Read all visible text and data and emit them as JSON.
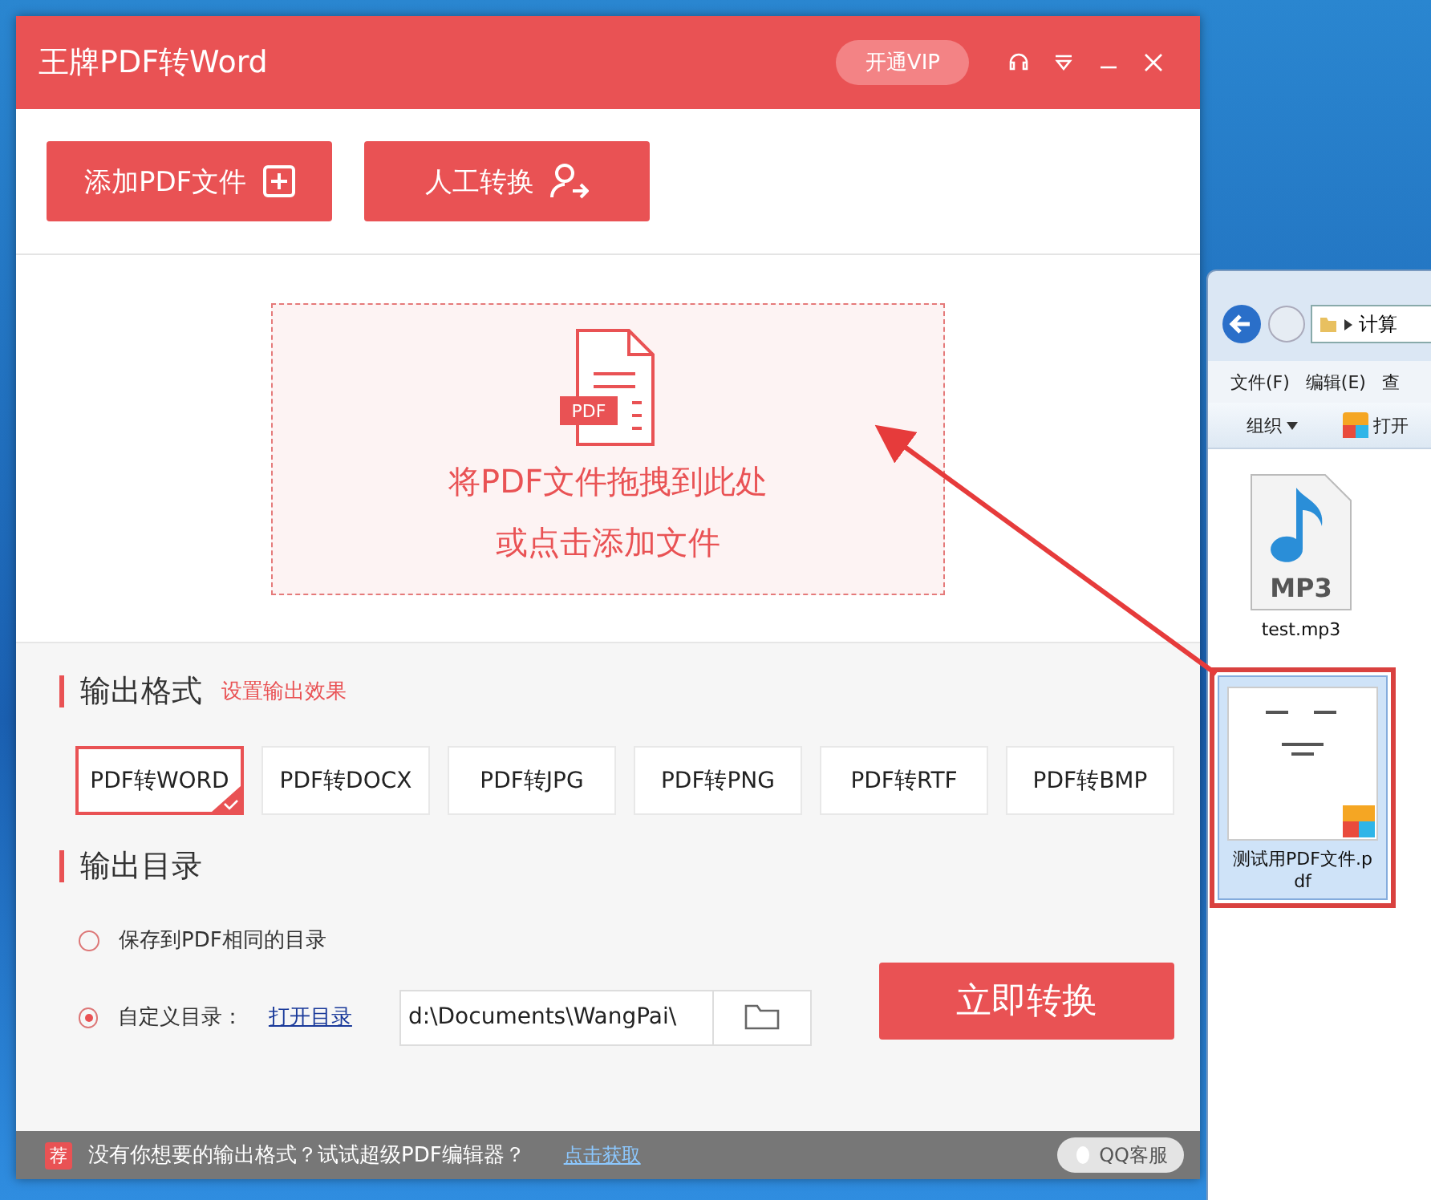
{
  "app": {
    "title": "王牌PDF转Word",
    "vip_button": "开通VIP",
    "toolbar": [
      {
        "label": "添加PDF文件",
        "kind": "add"
      },
      {
        "label": "人工转换",
        "kind": "person"
      }
    ],
    "drop_zone": {
      "badge": "PDF",
      "lines": [
        "将PDF文件拖拽到此处",
        "或点击添加文件"
      ]
    },
    "output_format": {
      "heading": "输出格式",
      "link": "设置输出效果",
      "options": [
        {
          "label": "PDF转WORD",
          "selected": true
        },
        {
          "label": "PDF转DOCX",
          "selected": false
        },
        {
          "label": "PDF转JPG",
          "selected": false
        },
        {
          "label": "PDF转PNG",
          "selected": false
        },
        {
          "label": "PDF转RTF",
          "selected": false
        },
        {
          "label": "PDF转BMP",
          "selected": false
        }
      ]
    },
    "output_dir": {
      "heading": "输出目录",
      "options": [
        {
          "label": "保存到PDF相同的目录",
          "selected": false
        },
        {
          "label": "自定义目录：",
          "selected": true,
          "link": "打开目录"
        }
      ],
      "path": "d:\\Documents\\WangPai\\"
    },
    "convert_button": "立即转换",
    "footer": {
      "badge": "荐",
      "text": "没有你想要的输出格式？试试超级PDF编辑器？",
      "link": "点击获取",
      "support": "QQ客服"
    }
  },
  "explorer": {
    "address": "计算",
    "menu": [
      "文件(F)",
      "编辑(E)",
      "查"
    ],
    "toolbar": [
      {
        "label": "组织",
        "kind": "dropdown"
      },
      {
        "label": "打开",
        "kind": "pdf"
      }
    ],
    "files": [
      {
        "name": "test.mp3",
        "kind": "mp3",
        "icon_text": "MP3",
        "selected": false
      },
      {
        "name": "测试用PDF文件.pdf",
        "kind": "pdf",
        "selected": true
      }
    ]
  }
}
